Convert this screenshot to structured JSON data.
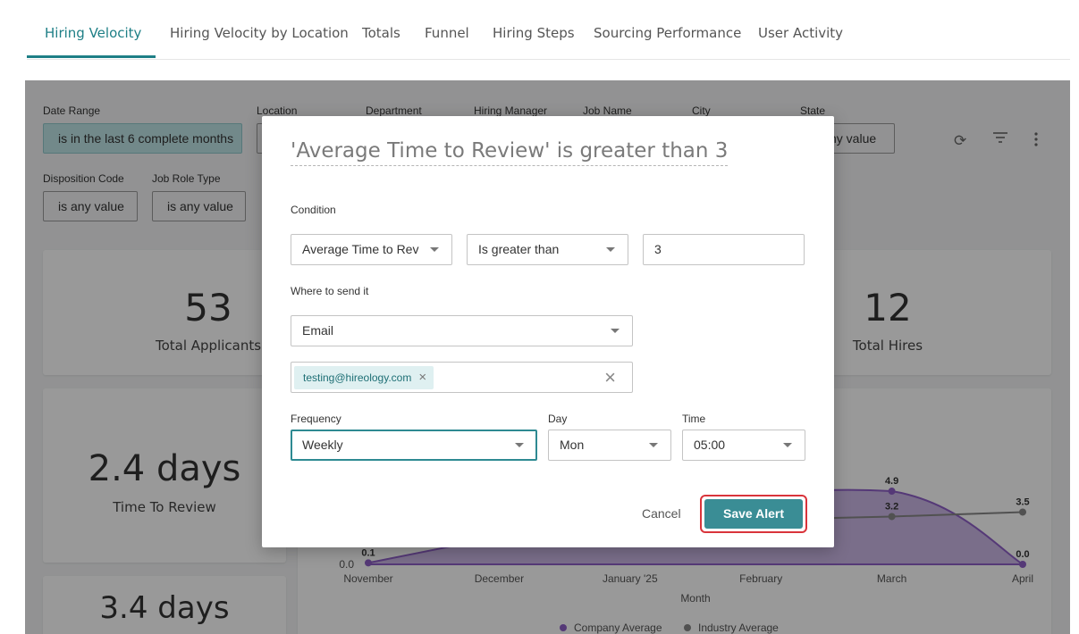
{
  "tabs": [
    {
      "label": "Hiring Velocity",
      "active": true
    },
    {
      "label": "Hiring Velocity by Location"
    },
    {
      "label": "Totals"
    },
    {
      "label": "Funnel"
    },
    {
      "label": "Hiring Steps"
    },
    {
      "label": "Sourcing Performance"
    },
    {
      "label": "User Activity"
    }
  ],
  "filters": {
    "date_range": {
      "label": "Date Range",
      "value": "is in the last 6 complete months"
    },
    "location": {
      "label": "Location"
    },
    "department": {
      "label": "Department"
    },
    "hiring_manager": {
      "label": "Hiring Manager"
    },
    "job_name": {
      "label": "Job Name"
    },
    "city": {
      "label": "City"
    },
    "state": {
      "label": "State",
      "value": "ny value"
    },
    "disposition_code": {
      "label": "Disposition Code",
      "value": "is any value"
    },
    "job_role_type": {
      "label": "Job Role Type",
      "value": "is any value"
    }
  },
  "toolbar_icons": [
    "refresh-icon",
    "filter-icon",
    "more-vert-icon"
  ],
  "tiles": {
    "total_applicants": {
      "value": "53",
      "label": "Total Applicants"
    },
    "total_hires": {
      "value": "12",
      "label": "Total Hires"
    },
    "time_to_review": {
      "value": "2.4 days",
      "label": "Time To Review"
    },
    "second": {
      "value": "3.4 days"
    }
  },
  "chart_data": {
    "type": "area",
    "categories": [
      "November",
      "December",
      "January '25",
      "February",
      "March",
      "April"
    ],
    "xlabel": "Month",
    "series": [
      {
        "name": "Company Average",
        "color": "#8e5fc7",
        "values": [
          0.1,
          null,
          null,
          null,
          4.9,
          0.0
        ]
      },
      {
        "name": "Industry Average",
        "color": "#888888",
        "values": [
          null,
          null,
          null,
          null,
          3.2,
          3.5
        ]
      }
    ],
    "y_tick_labels": [
      "0.0"
    ],
    "data_labels": [
      "0.1",
      "4.9",
      "3.2",
      "3.5",
      "0.0"
    ]
  },
  "modal": {
    "title": "'Average Time to Review' is greater than 3",
    "condition_label": "Condition",
    "condition_field": "Average Time to Rev",
    "condition_operator": "Is greater than",
    "condition_value": "3",
    "where_label": "Where to send it",
    "channel": "Email",
    "recipient": "testing@hireology.com",
    "frequency_label": "Frequency",
    "frequency": "Weekly",
    "day_label": "Day",
    "day": "Mon",
    "time_label": "Time",
    "time": "05:00",
    "cancel_label": "Cancel",
    "save_label": "Save Alert"
  }
}
